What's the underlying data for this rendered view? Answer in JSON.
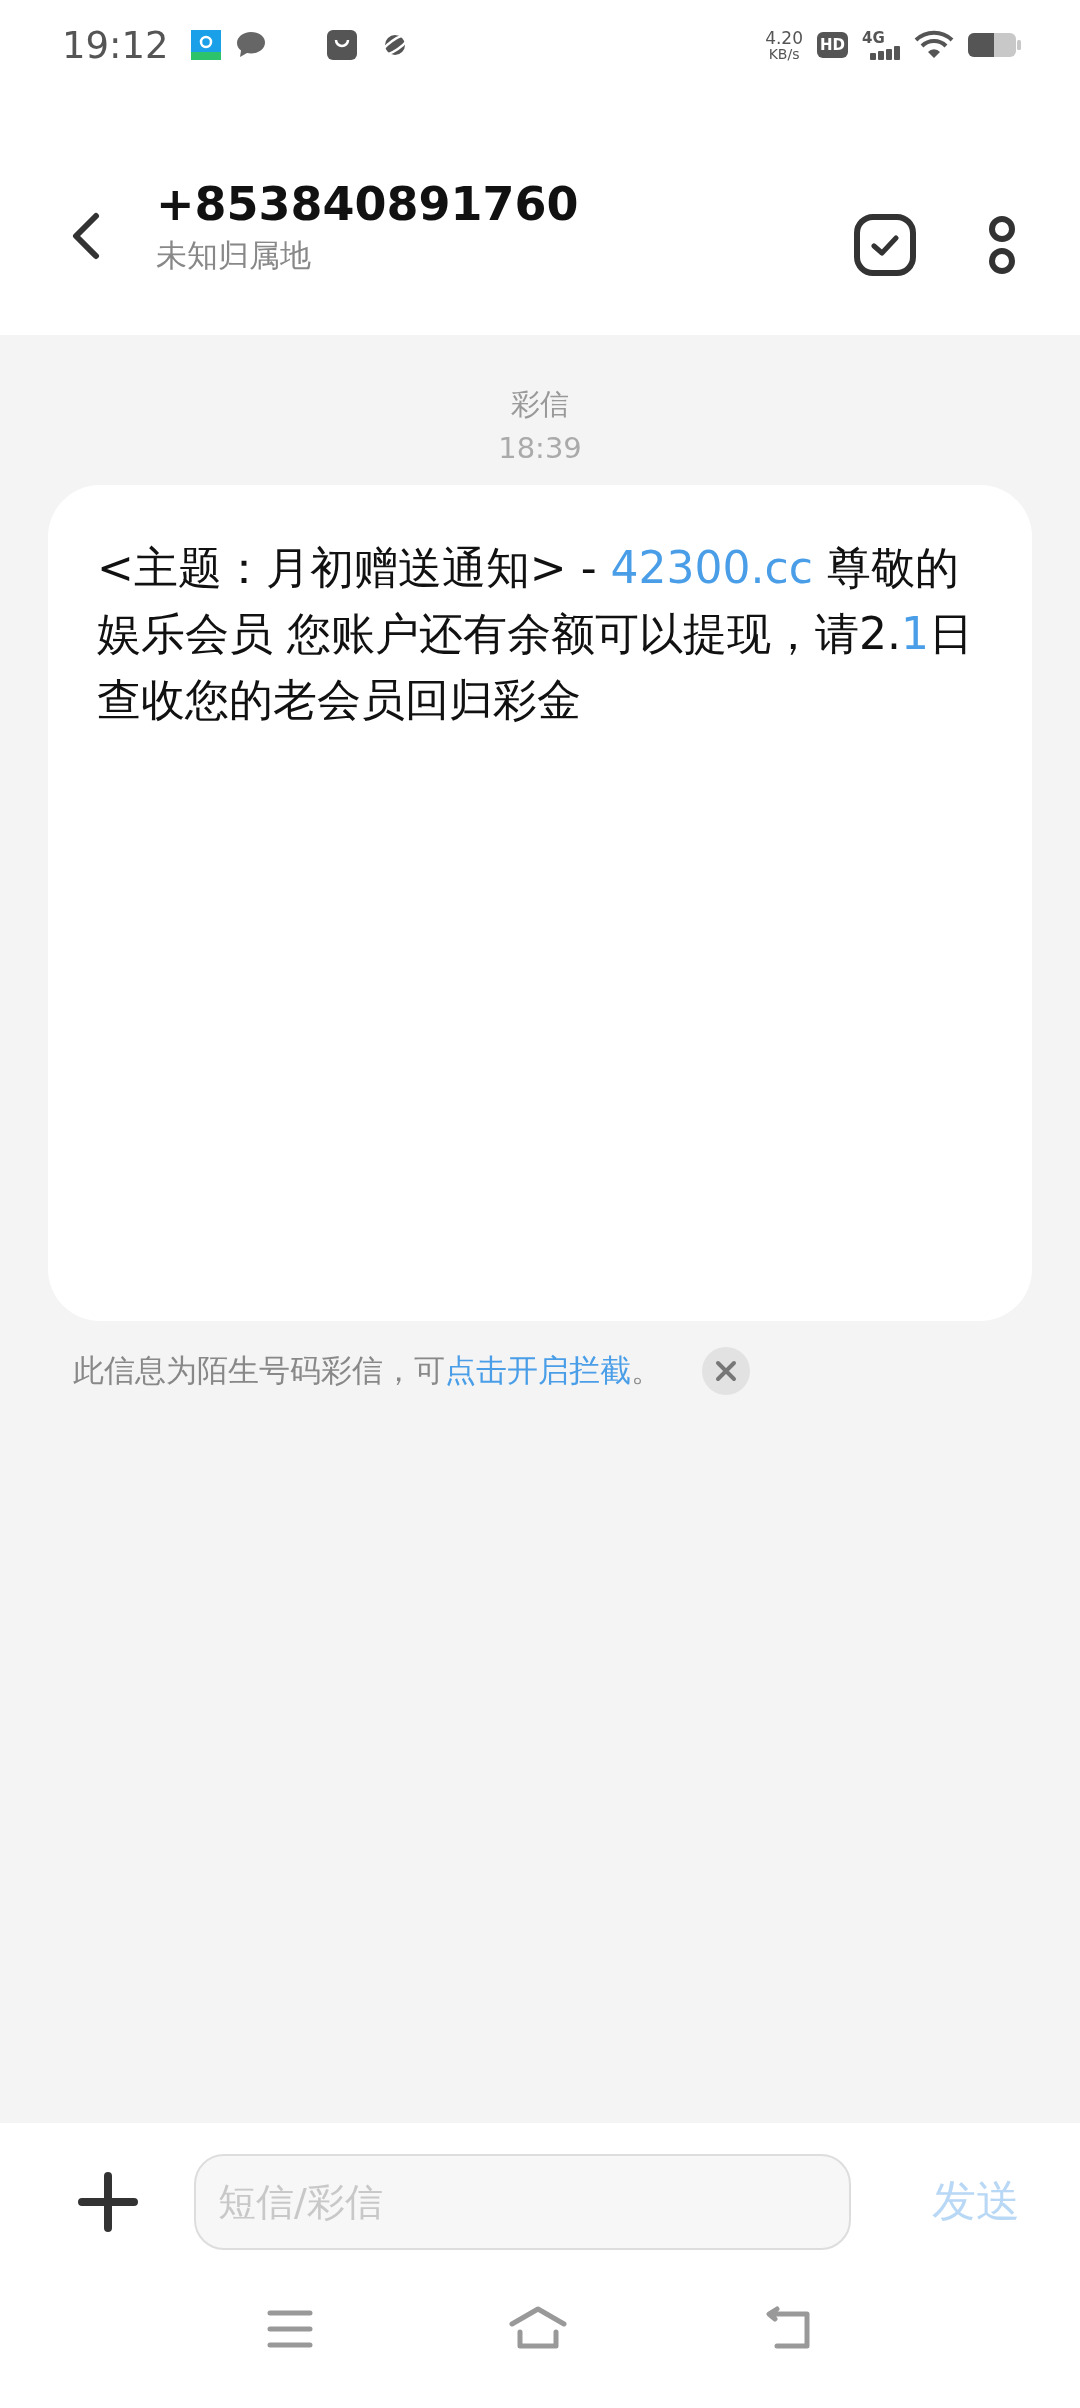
{
  "status_bar": {
    "time": "19:12",
    "net_speed": "4.20",
    "net_speed_unit": "KB/s",
    "hd_badge": "HD",
    "network": "4G"
  },
  "header": {
    "title": "+853840891760",
    "subtitle": "未知归属地"
  },
  "conversation": {
    "message_type": "彩信",
    "time": "18:39",
    "message": {
      "segments": [
        {
          "kind": "plain",
          "text": "<主题：月初赠送通知> - "
        },
        {
          "kind": "link",
          "text": "42300.cc"
        },
        {
          "kind": "plain",
          "text": " 尊敬的娱乐会员 您账户还有余额可以提现，请2."
        },
        {
          "kind": "link",
          "text": "1"
        },
        {
          "kind": "plain",
          "text": "日查收您的老会员回归彩金"
        }
      ]
    },
    "notice": {
      "segments": [
        {
          "kind": "plain",
          "text": "此信息为陌生号码彩信，可"
        },
        {
          "kind": "link",
          "text": "点击开启拦截"
        },
        {
          "kind": "plain",
          "text": "。"
        }
      ]
    }
  },
  "composer": {
    "placeholder": "短信/彩信",
    "send_label": "发送"
  }
}
